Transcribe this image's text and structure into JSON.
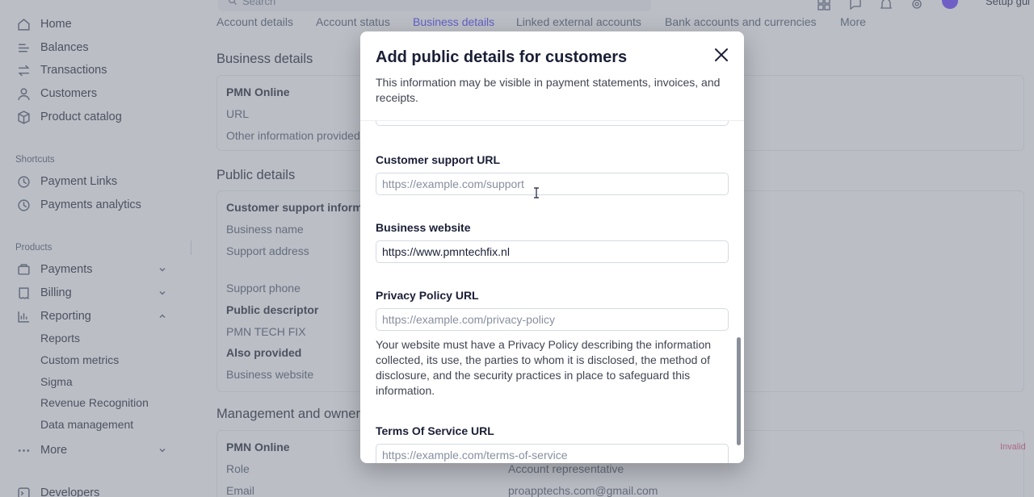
{
  "sidebar": {
    "main_items": [
      {
        "label": "Home",
        "icon": "home-icon"
      },
      {
        "label": "Balances",
        "icon": "balances-icon"
      },
      {
        "label": "Transactions",
        "icon": "transactions-icon"
      },
      {
        "label": "Customers",
        "icon": "customers-icon"
      },
      {
        "label": "Product catalog",
        "icon": "product-catalog-icon"
      }
    ],
    "shortcuts_label": "Shortcuts",
    "shortcuts": [
      {
        "label": "Payment Links",
        "icon": "clock-icon"
      },
      {
        "label": "Payments analytics",
        "icon": "clock-icon"
      }
    ],
    "products_label": "Products",
    "products": [
      {
        "label": "Payments",
        "icon": "payments-icon"
      },
      {
        "label": "Billing",
        "icon": "billing-icon"
      },
      {
        "label": "Reporting",
        "icon": "reporting-icon"
      }
    ],
    "reporting_sub": [
      "Reports",
      "Custom metrics",
      "Sigma",
      "Revenue Recognition",
      "Data management"
    ],
    "more_label": "More",
    "developers_label": "Developers"
  },
  "topbar": {
    "search_placeholder": "Search",
    "setup_label": "Setup gui"
  },
  "tabs": [
    {
      "label": "Account details",
      "active": false
    },
    {
      "label": "Account status",
      "active": false
    },
    {
      "label": "Business details",
      "active": true
    },
    {
      "label": "Linked external accounts",
      "active": false
    },
    {
      "label": "Bank accounts and currencies",
      "active": false
    },
    {
      "label": "More",
      "active": false
    }
  ],
  "background": {
    "business_details_heading": "Business details",
    "business_card": {
      "name": "PMN Online",
      "url_label": "URL",
      "other_info_label": "Other information provided"
    },
    "public_details_heading": "Public details",
    "public_card": {
      "support_info": "Customer support informa",
      "business_name": "Business name",
      "support_address": "Support address",
      "support_phone": "Support phone",
      "public_descriptor_label": "Public descriptor",
      "public_descriptor_value": "PMN TECH FIX",
      "also_provided_label": "Also provided",
      "business_website": "Business website"
    },
    "management_heading": "Management and owners",
    "management_card": {
      "name": "PMN Online",
      "role_label": "Role",
      "role_value": "Account representative",
      "email_label": "Email",
      "email_value": "proapptechs.com@gmail.com",
      "invalid_badge": "Invalid"
    }
  },
  "modal": {
    "title": "Add public details for customers",
    "description": "This information may be visible in payment statements, invoices, and receipts.",
    "fields": {
      "support_url": {
        "label": "Customer support URL",
        "value": "",
        "placeholder": "https://example.com/support"
      },
      "website": {
        "label": "Business website",
        "value": "https://www.pmntechfix.nl",
        "placeholder": ""
      },
      "privacy": {
        "label": "Privacy Policy URL",
        "value": "",
        "placeholder": "https://example.com/privacy-policy",
        "help": "Your website must have a Privacy Policy describing the information collected, its use, the parties to whom it is disclosed, the method of disclosure, and the security practices in place to safeguard this information."
      },
      "terms": {
        "label": "Terms Of Service URL",
        "value": "",
        "placeholder": "https://example.com/terms-of-service"
      }
    }
  },
  "colors": {
    "accent": "#635bff",
    "overlay": "#5c6474",
    "text": "#414552"
  }
}
